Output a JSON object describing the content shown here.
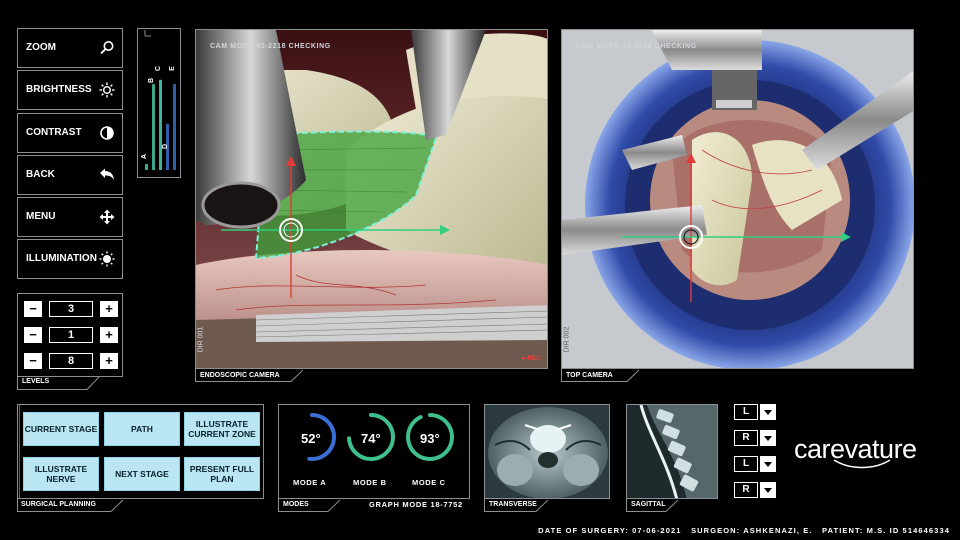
{
  "tools": [
    {
      "label": "ZOOM",
      "icon": "zoom-icon"
    },
    {
      "label": "BRIGHTNESS",
      "icon": "brightness-icon"
    },
    {
      "label": "CONTRAST",
      "icon": "contrast-icon"
    },
    {
      "label": "BACK",
      "icon": "back-arrow-icon"
    },
    {
      "label": "MENU",
      "icon": "move-arrows-icon"
    },
    {
      "label": "ILLUMINATION",
      "icon": "illumination-icon"
    }
  ],
  "meter": {
    "labels": [
      "A",
      "B",
      "C",
      "D",
      "E"
    ],
    "levels": [
      0.04,
      0.78,
      0.82,
      0.42,
      0.78
    ],
    "colors": [
      "#39a88e",
      "#39a88e",
      "#3fb5a0",
      "#2f5fa8",
      "#2f5fa8"
    ]
  },
  "levels": {
    "values": [
      "3",
      "1",
      "8"
    ],
    "minus": "−",
    "plus": "+",
    "title": "LEVELS"
  },
  "endoscopic": {
    "mode_text": "CAM MODE 43-2218 CHECKING",
    "side_text": "DIR 001",
    "rec_text": "● REC",
    "tab": "ENDOSCOPIC CAMERA"
  },
  "top_camera": {
    "mode_text": "CAM MODE 12-5658 CHECKING",
    "side_text": "DIR 002",
    "tab": "TOP CAMERA"
  },
  "planning": {
    "buttons": [
      "CURRENT STAGE",
      "PATH",
      "ILLUSTRATE CURRENT ZONE",
      "ILLUSTRATE NERVE",
      "NEXT STAGE",
      "PRESENT FULL PLAN"
    ],
    "title": "SURGICAL PLANNING"
  },
  "modes": {
    "items": [
      {
        "value": "52°",
        "label": "MODE A",
        "fraction": 0.52,
        "color": "#3a6fd6"
      },
      {
        "value": "74°",
        "label": "MODE B",
        "fraction": 0.74,
        "color": "#3fbf8c"
      },
      {
        "value": "93°",
        "label": "MODE C",
        "fraction": 0.93,
        "color": "#3fbf8c"
      }
    ],
    "title": "MODES",
    "graph_text": "GRAPH MODE 18-7752"
  },
  "scans": {
    "transverse": "TRANSVERSE",
    "sagittal": "SAGITTAL"
  },
  "selectors": [
    "L",
    "R",
    "L",
    "R"
  ],
  "brand": {
    "part1": "care",
    "part2": "vature"
  },
  "footer": "DATE OF SURGERY: 07-06-2021   SURGEON: ASHKENAZI, E.   PATIENT: M.S. ID 514646334"
}
